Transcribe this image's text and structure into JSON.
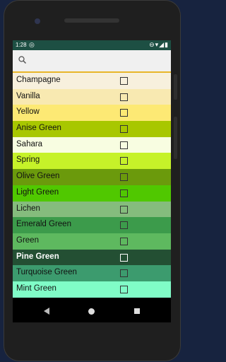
{
  "status": {
    "time": "1:28",
    "left_icon": "sync-icon",
    "right_icons": "⊖▾◢▮"
  },
  "search": {
    "placeholder": ""
  },
  "rows": [
    {
      "label": "Champagne",
      "bg": "#f7f0dd",
      "fg": "#111"
    },
    {
      "label": "Vanilla",
      "bg": "#f8e9b1",
      "fg": "#111"
    },
    {
      "label": "Yellow",
      "bg": "#fde974",
      "fg": "#111"
    },
    {
      "label": "Anise Green",
      "bg": "#a8c700",
      "fg": "#111"
    },
    {
      "label": "Sahara",
      "bg": "#f8fde1",
      "fg": "#111"
    },
    {
      "label": "Spring",
      "bg": "#c6f229",
      "fg": "#111"
    },
    {
      "label": "Olive Green",
      "bg": "#6b9a0c",
      "fg": "#111"
    },
    {
      "label": "Light Green",
      "bg": "#50c800",
      "fg": "#111"
    },
    {
      "label": "Lichen",
      "bg": "#85bc7d",
      "fg": "#111"
    },
    {
      "label": "Emerald Green",
      "bg": "#3c9b4b",
      "fg": "#111"
    },
    {
      "label": "Green",
      "bg": "#5eb95f",
      "fg": "#111"
    },
    {
      "label": "Pine Green",
      "bg": "#234f33",
      "fg": "#ffffff",
      "dark": true
    },
    {
      "label": "Turquoise Green",
      "bg": "#3c9b6e",
      "fg": "#111"
    },
    {
      "label": "Mint Green",
      "bg": "#80fcc7",
      "fg": "#111"
    }
  ]
}
